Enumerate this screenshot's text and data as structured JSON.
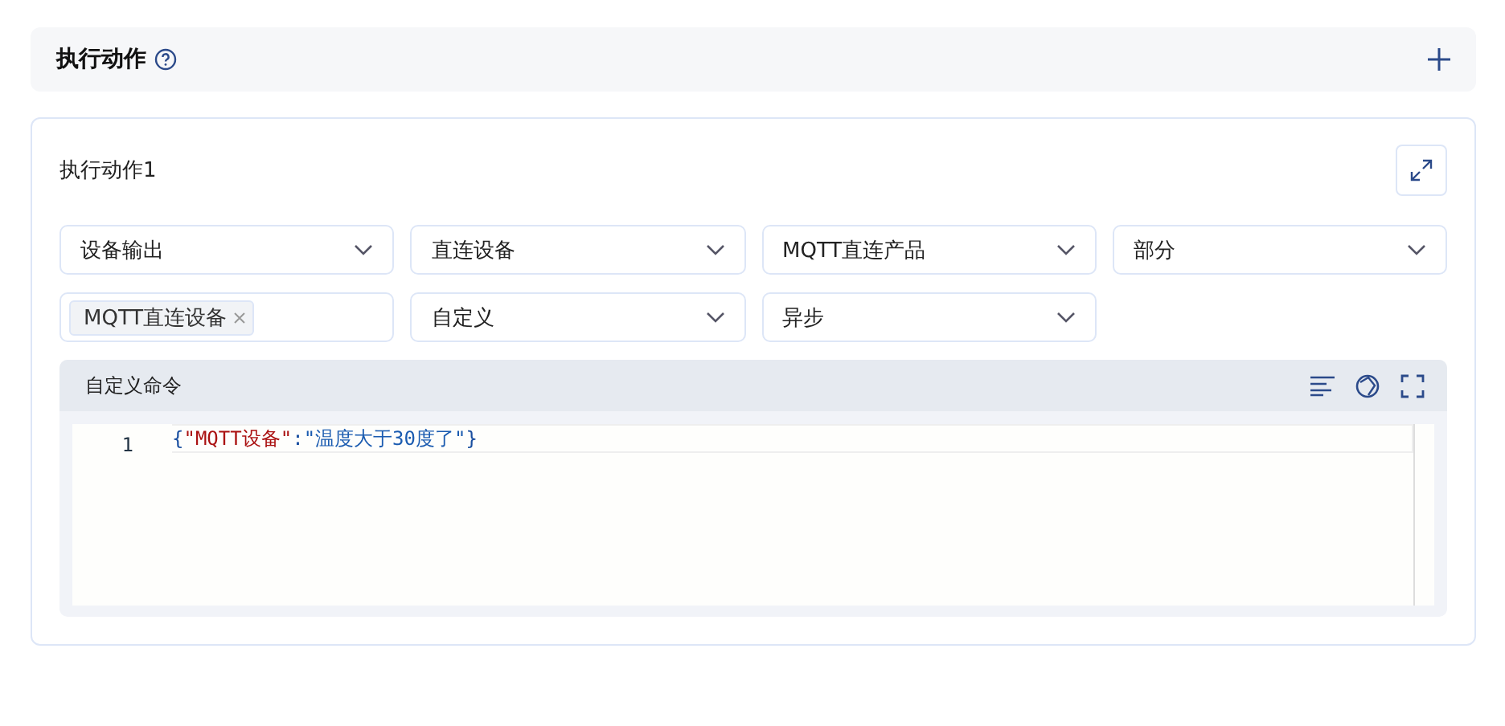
{
  "section": {
    "title": "执行动作"
  },
  "action": {
    "title": "执行动作1",
    "fields": [
      {
        "kind": "select",
        "value": "设备输出"
      },
      {
        "kind": "select",
        "value": "直连设备"
      },
      {
        "kind": "select",
        "value": "MQTT直连产品"
      },
      {
        "kind": "select",
        "value": "部分"
      },
      {
        "kind": "tags",
        "tags": [
          "MQTT直连设备"
        ]
      },
      {
        "kind": "select",
        "value": "自定义"
      },
      {
        "kind": "select",
        "value": "异步"
      }
    ],
    "editor": {
      "title": "自定义命令",
      "lines": [
        {
          "number": "1",
          "tokens": [
            {
              "kind": "punct",
              "text": "{"
            },
            {
              "kind": "key",
              "text": "\"MQTT设备\""
            },
            {
              "kind": "punct",
              "text": ":"
            },
            {
              "kind": "string",
              "text": "\"温度大于30度了\""
            },
            {
              "kind": "punct",
              "text": "}"
            }
          ]
        }
      ]
    }
  }
}
